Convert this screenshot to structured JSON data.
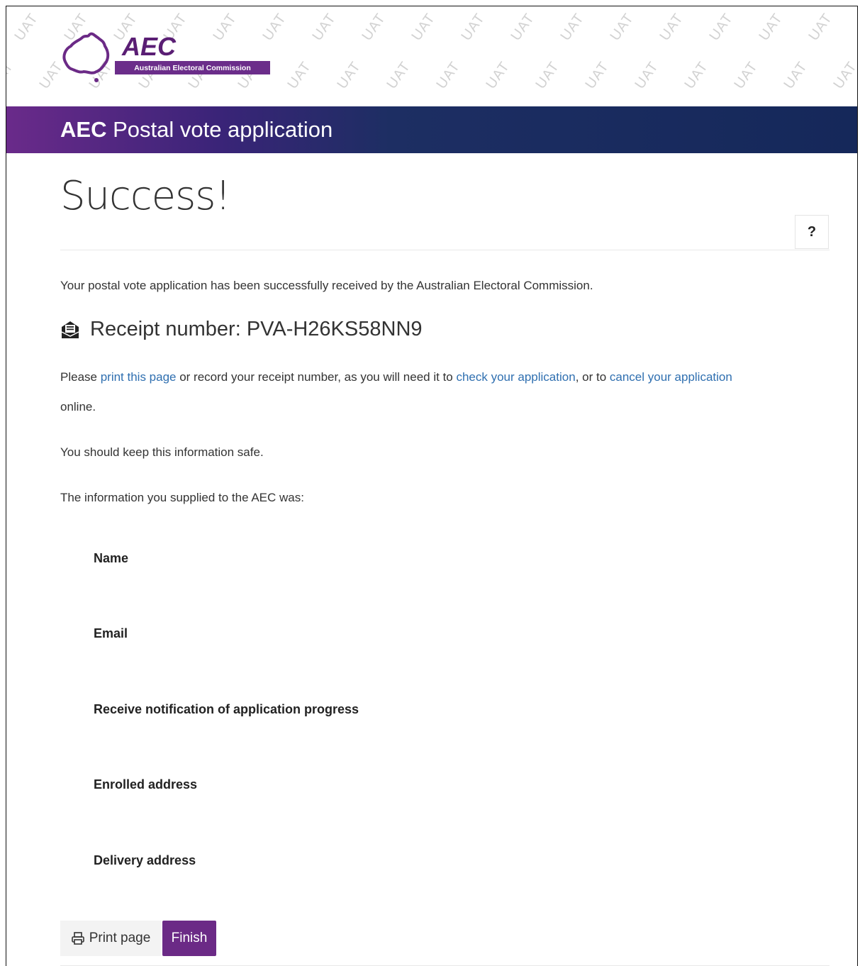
{
  "header": {
    "watermark_text": "UAT",
    "logo_name": "AEC",
    "logo_strip": "Australian Electoral Commission",
    "banner_prefix": "AEC",
    "banner_suffix": " Postal vote application"
  },
  "main": {
    "title": "Success!",
    "help_label": "?",
    "intro": "Your postal vote application has been successfully received by the Australian Electoral Commission.",
    "receipt_label": "Receipt number: PVA-H26KS58NN9",
    "instructions": {
      "t1": "Please ",
      "link_print": "print this page",
      "t2": " or record your receipt number, as you will need it to ",
      "link_check": "check your application",
      "t3": ", or to ",
      "link_cancel": "cancel your application",
      "t4": "online."
    },
    "keep_safe": "You should keep this information safe.",
    "supplied": "The information you supplied to the AEC was:",
    "fields": [
      {
        "label": "Name"
      },
      {
        "label": "Email"
      },
      {
        "label": "Receive notification of application progress"
      },
      {
        "label": "Enrolled address"
      },
      {
        "label": "Delivery address"
      }
    ]
  },
  "actions": {
    "print_label": "Print page",
    "finish_label": "Finish"
  },
  "colors": {
    "brand_purple": "#6b2a86",
    "banner_navy": "#15285a",
    "link": "#2f6fb0"
  }
}
